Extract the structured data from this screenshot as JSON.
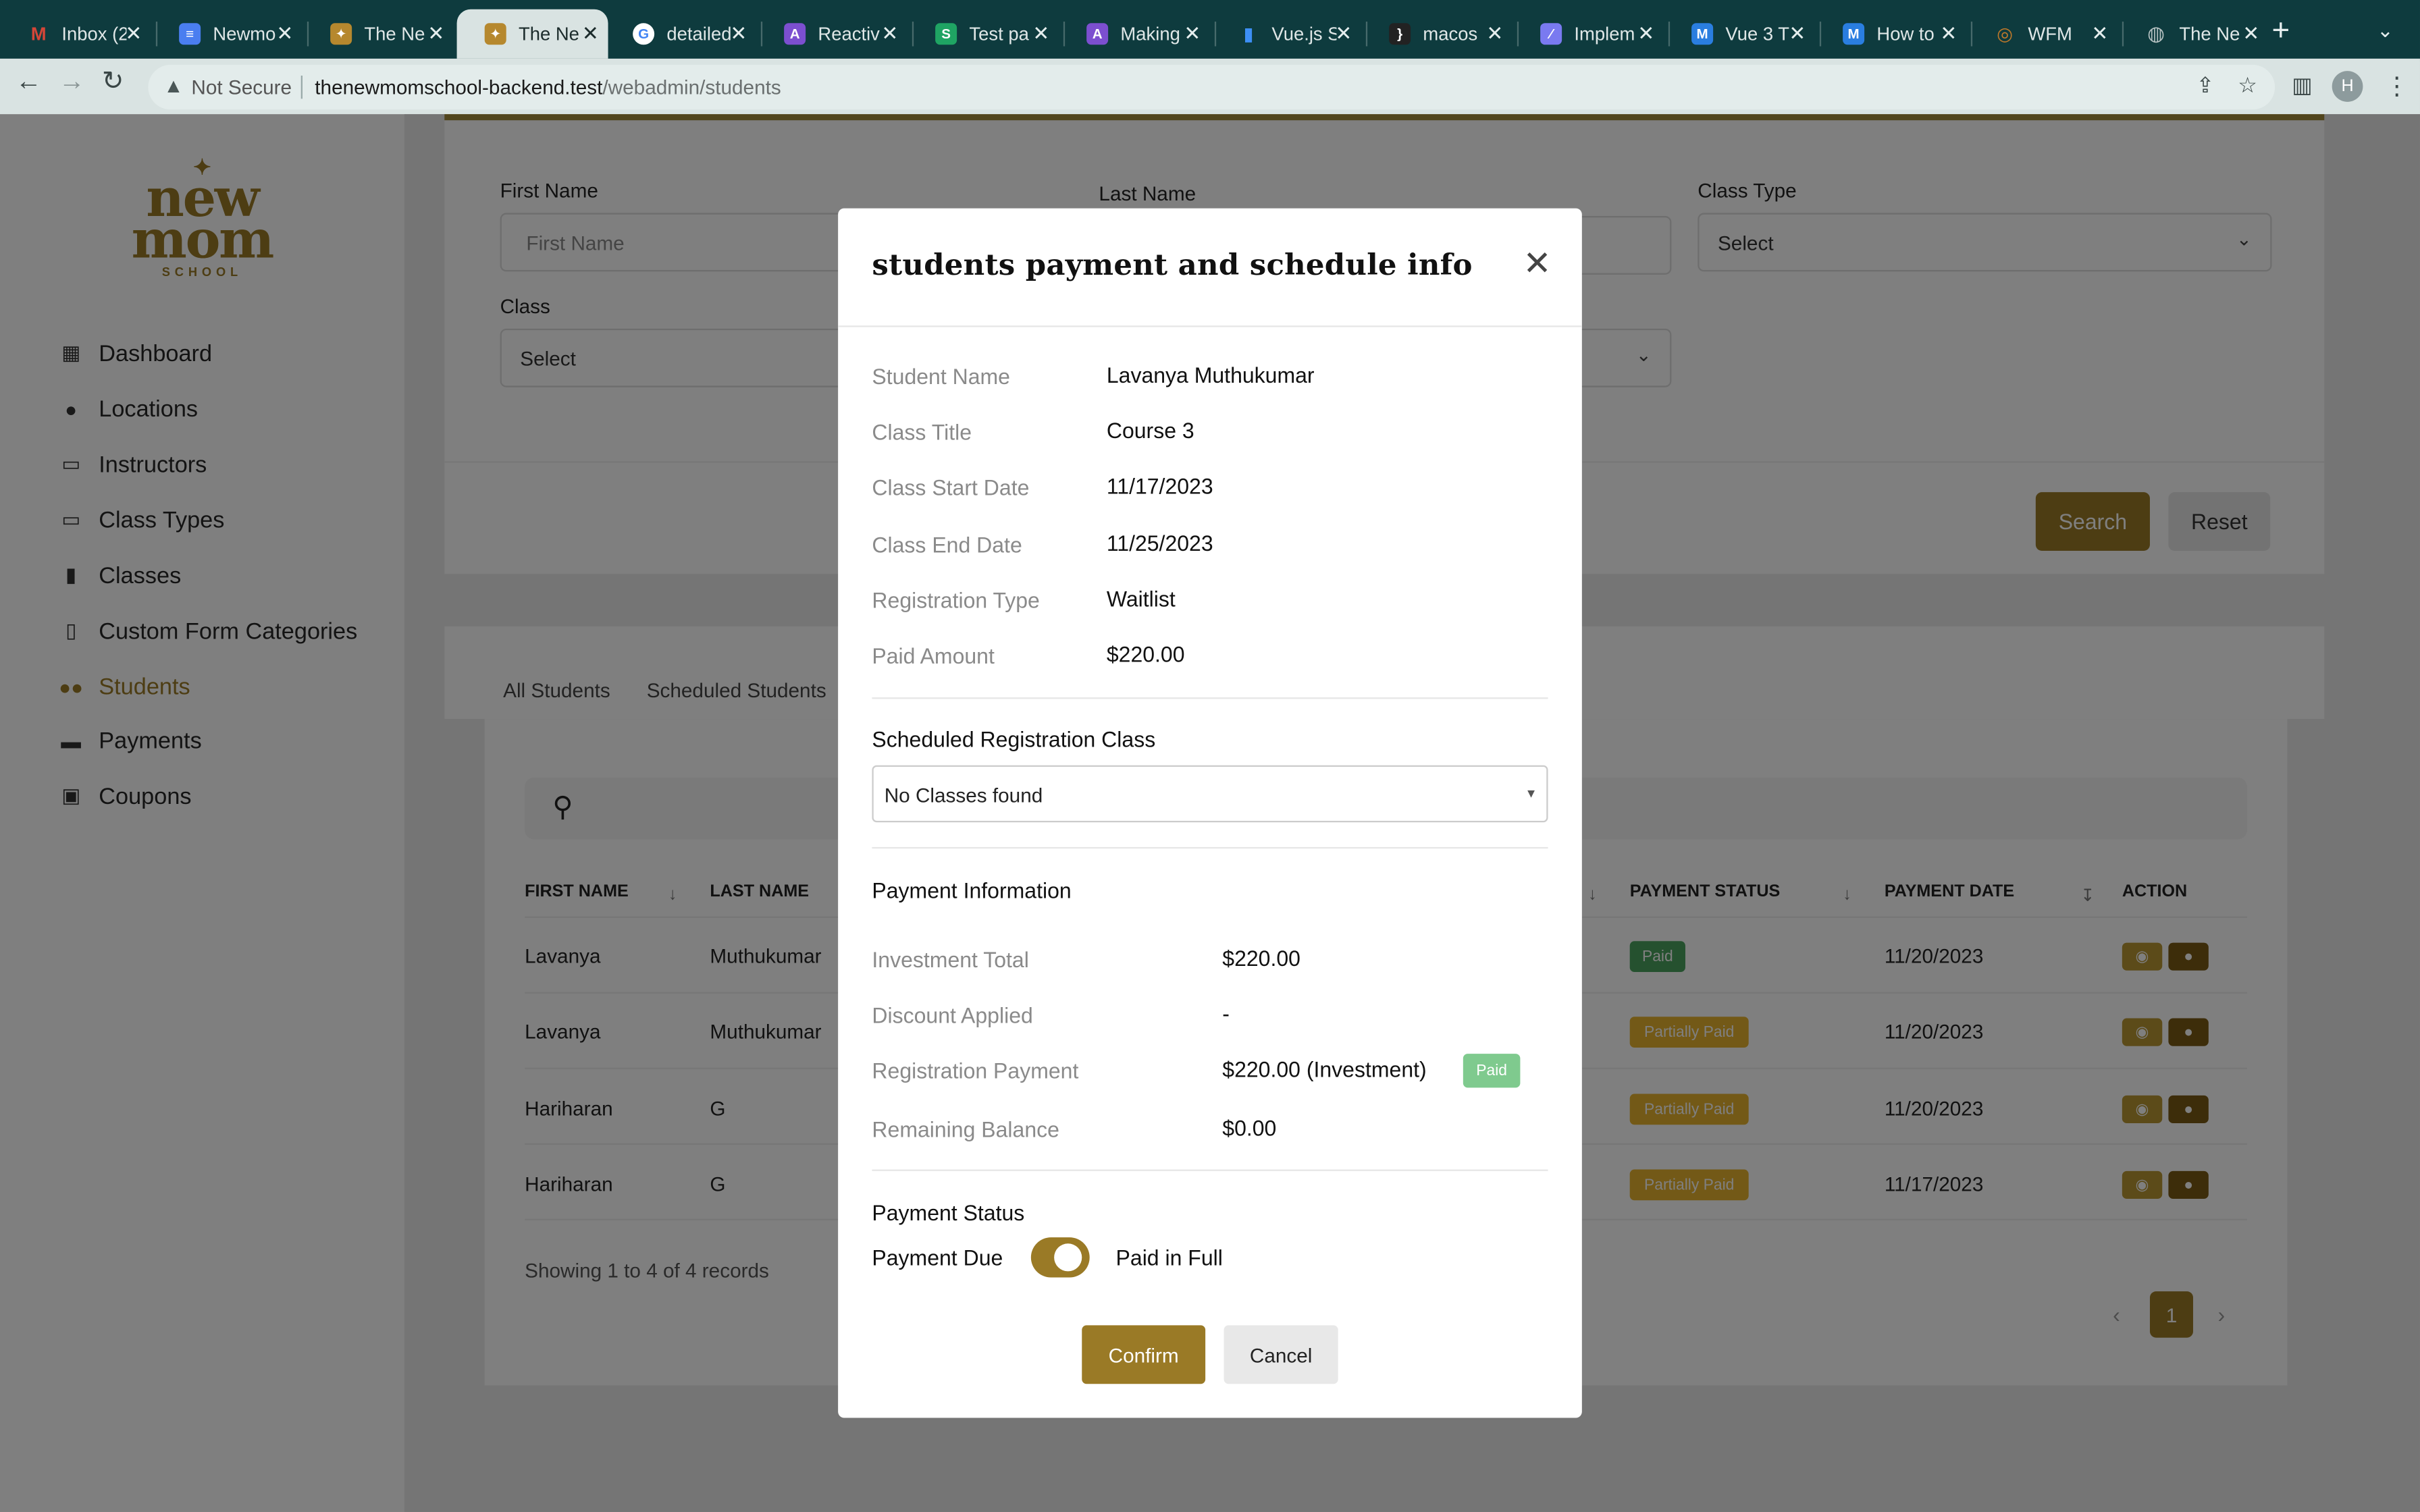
{
  "browser": {
    "tabs": [
      {
        "title": "Inbox (2",
        "icon": "gmail-icon",
        "color": "#d44638",
        "glyph": "M"
      },
      {
        "title": "Newmo",
        "icon": "docs-icon",
        "color": "#4a7ef0",
        "glyph": "≡"
      },
      {
        "title": "The Ne",
        "icon": "newmom-icon",
        "color": "#b6882e",
        "glyph": "✦"
      },
      {
        "title": "The Ne",
        "icon": "newmom-icon",
        "color": "#b6882e",
        "glyph": "✦"
      },
      {
        "title": "detailed",
        "icon": "google-icon",
        "color": "#ffffff",
        "glyph": "G"
      },
      {
        "title": "Reactiv",
        "icon": "astro-icon",
        "color": "#7c4fd0",
        "glyph": "A"
      },
      {
        "title": "Test pa",
        "icon": "sheets-icon",
        "color": "#1fa463",
        "glyph": "S"
      },
      {
        "title": "Making",
        "icon": "astro-icon",
        "color": "#7c4fd0",
        "glyph": "A"
      },
      {
        "title": "Vue.js S",
        "icon": "chart-icon",
        "color": "#3d8ff5",
        "glyph": "▮"
      },
      {
        "title": "macos",
        "icon": "bracket-icon",
        "color": "#222222",
        "glyph": "}"
      },
      {
        "title": "Implem",
        "icon": "linear-icon",
        "color": "#7a7af0",
        "glyph": "⁄"
      },
      {
        "title": "Vue 3 T",
        "icon": "m-icon",
        "color": "#2a7ee0",
        "glyph": "M"
      },
      {
        "title": "How to",
        "icon": "m-icon",
        "color": "#2a7ee0",
        "glyph": "M"
      },
      {
        "title": "WFM",
        "icon": "wfm-icon",
        "color": "#c27a2a",
        "glyph": "◎"
      },
      {
        "title": "The Ne",
        "icon": "globe-icon",
        "color": "#8b9a9a",
        "glyph": "◍"
      }
    ],
    "security_label": "Not Secure",
    "url_host": "thenewmomschool-backend.test",
    "url_path": "/webadmin/students",
    "avatar_initial": "H"
  },
  "logo": {
    "line1": "new",
    "line2": "mom",
    "line3": "SCHOOL"
  },
  "sidebar": {
    "items": [
      {
        "label": "Dashboard",
        "icon": "dashboard-icon",
        "glyph": "▦"
      },
      {
        "label": "Locations",
        "icon": "map-pin-icon",
        "glyph": "●"
      },
      {
        "label": "Instructors",
        "icon": "instructor-icon",
        "glyph": "▭"
      },
      {
        "label": "Class Types",
        "icon": "laptop-icon",
        "glyph": "▭"
      },
      {
        "label": "Classes",
        "icon": "book-icon",
        "glyph": "▮"
      },
      {
        "label": "Custom Form Categories",
        "icon": "file-icon",
        "glyph": "▯"
      },
      {
        "label": "Students",
        "icon": "users-icon",
        "glyph": "●●"
      },
      {
        "label": "Payments",
        "icon": "card-icon",
        "glyph": "▬"
      },
      {
        "label": "Coupons",
        "icon": "gift-icon",
        "glyph": "▣"
      }
    ],
    "active": "Students"
  },
  "filters": {
    "first_name_label": "First Name",
    "first_name_placeholder": "First Name",
    "last_name_label": "Last Name",
    "class_type_label": "Class Type",
    "class_type_value": "Select",
    "class_label": "Class",
    "class_value": "Select",
    "search_label": "Search",
    "reset_label": "Reset"
  },
  "student_tabs": [
    "All Students",
    "Scheduled Students"
  ],
  "table": {
    "headers": {
      "first_name": "FIRST NAME",
      "last_name": "LAST NAME",
      "payment_status": "PAYMENT STATUS",
      "payment_date": "PAYMENT DATE",
      "action": "ACTION"
    },
    "rows": [
      {
        "first": "Lavanya",
        "last": "Muthukumar",
        "status": "Paid",
        "date": "11/20/2023"
      },
      {
        "first": "Lavanya",
        "last": "Muthukumar",
        "status": "Partially Paid",
        "date": "11/20/2023"
      },
      {
        "first": "Hariharan",
        "last": "G",
        "status": "Partially Paid",
        "date": "11/20/2023"
      },
      {
        "first": "Hariharan",
        "last": "G",
        "status": "Partially Paid",
        "date": "11/17/2023"
      }
    ],
    "records_text": "Showing 1 to 4 of 4 records",
    "current_page": "1"
  },
  "modal": {
    "title": "students payment and schedule info",
    "details": [
      {
        "label": "Student Name",
        "value": "Lavanya Muthukumar"
      },
      {
        "label": "Class Title",
        "value": "Course 3"
      },
      {
        "label": "Class Start Date",
        "value": "11/17/2023"
      },
      {
        "label": "Class End Date",
        "value": "11/25/2023"
      },
      {
        "label": "Registration Type",
        "value": "Waitlist"
      },
      {
        "label": "Paid Amount",
        "value": "$220.00"
      }
    ],
    "scheduled_heading": "Scheduled Registration Class",
    "scheduled_value": "No Classes found",
    "payment_heading": "Payment Information",
    "payment": [
      {
        "label": "Investment Total",
        "value": "$220.00"
      },
      {
        "label": "Discount Applied",
        "value": "-"
      },
      {
        "label": "Registration Payment",
        "value": "$220.00 (Investment)"
      },
      {
        "label": "Remaining Balance",
        "value": "$0.00"
      }
    ],
    "registration_badge": "Paid",
    "status_heading": "Payment Status",
    "toggle_left": "Payment Due",
    "toggle_right": "Paid in Full",
    "toggle_on": true,
    "confirm_label": "Confirm",
    "cancel_label": "Cancel"
  },
  "colors": {
    "brand": "#9a7a26",
    "paid": "#4ba35f",
    "partial": "#e6b22e"
  }
}
